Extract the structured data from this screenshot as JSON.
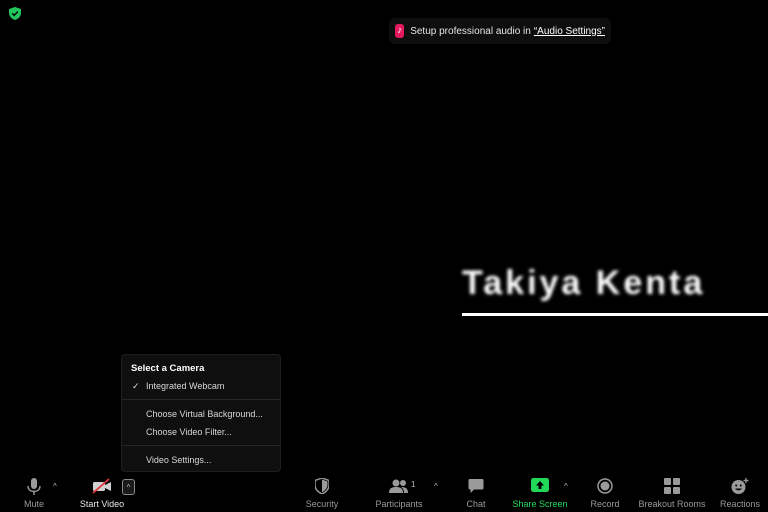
{
  "banner": {
    "text": "Setup professional audio in",
    "link": "“Audio Settings”",
    "icon": "music-note-icon"
  },
  "video_area": {
    "participant_name": "Takiya Kenta"
  },
  "camera_menu": {
    "title": "Select a Camera",
    "items": [
      {
        "label": "Integrated Webcam",
        "checked": true
      },
      {
        "label": "Choose Virtual Background..."
      },
      {
        "label": "Choose Video Filter..."
      },
      {
        "label": "Video Settings..."
      }
    ]
  },
  "toolbar": {
    "mute": "Mute",
    "start_video": "Start Video",
    "security": "Security",
    "participants": "Participants",
    "participants_count": "1",
    "chat": "Chat",
    "share_screen": "Share Screen",
    "record": "Record",
    "breakout_rooms": "Breakout Rooms",
    "reactions": "Reactions",
    "caret": "^"
  },
  "colors": {
    "share_green": "#23d959",
    "shield_green": "#22c55e",
    "stop_video_red": "#e0383e",
    "banner_icon": "#e5195c"
  }
}
